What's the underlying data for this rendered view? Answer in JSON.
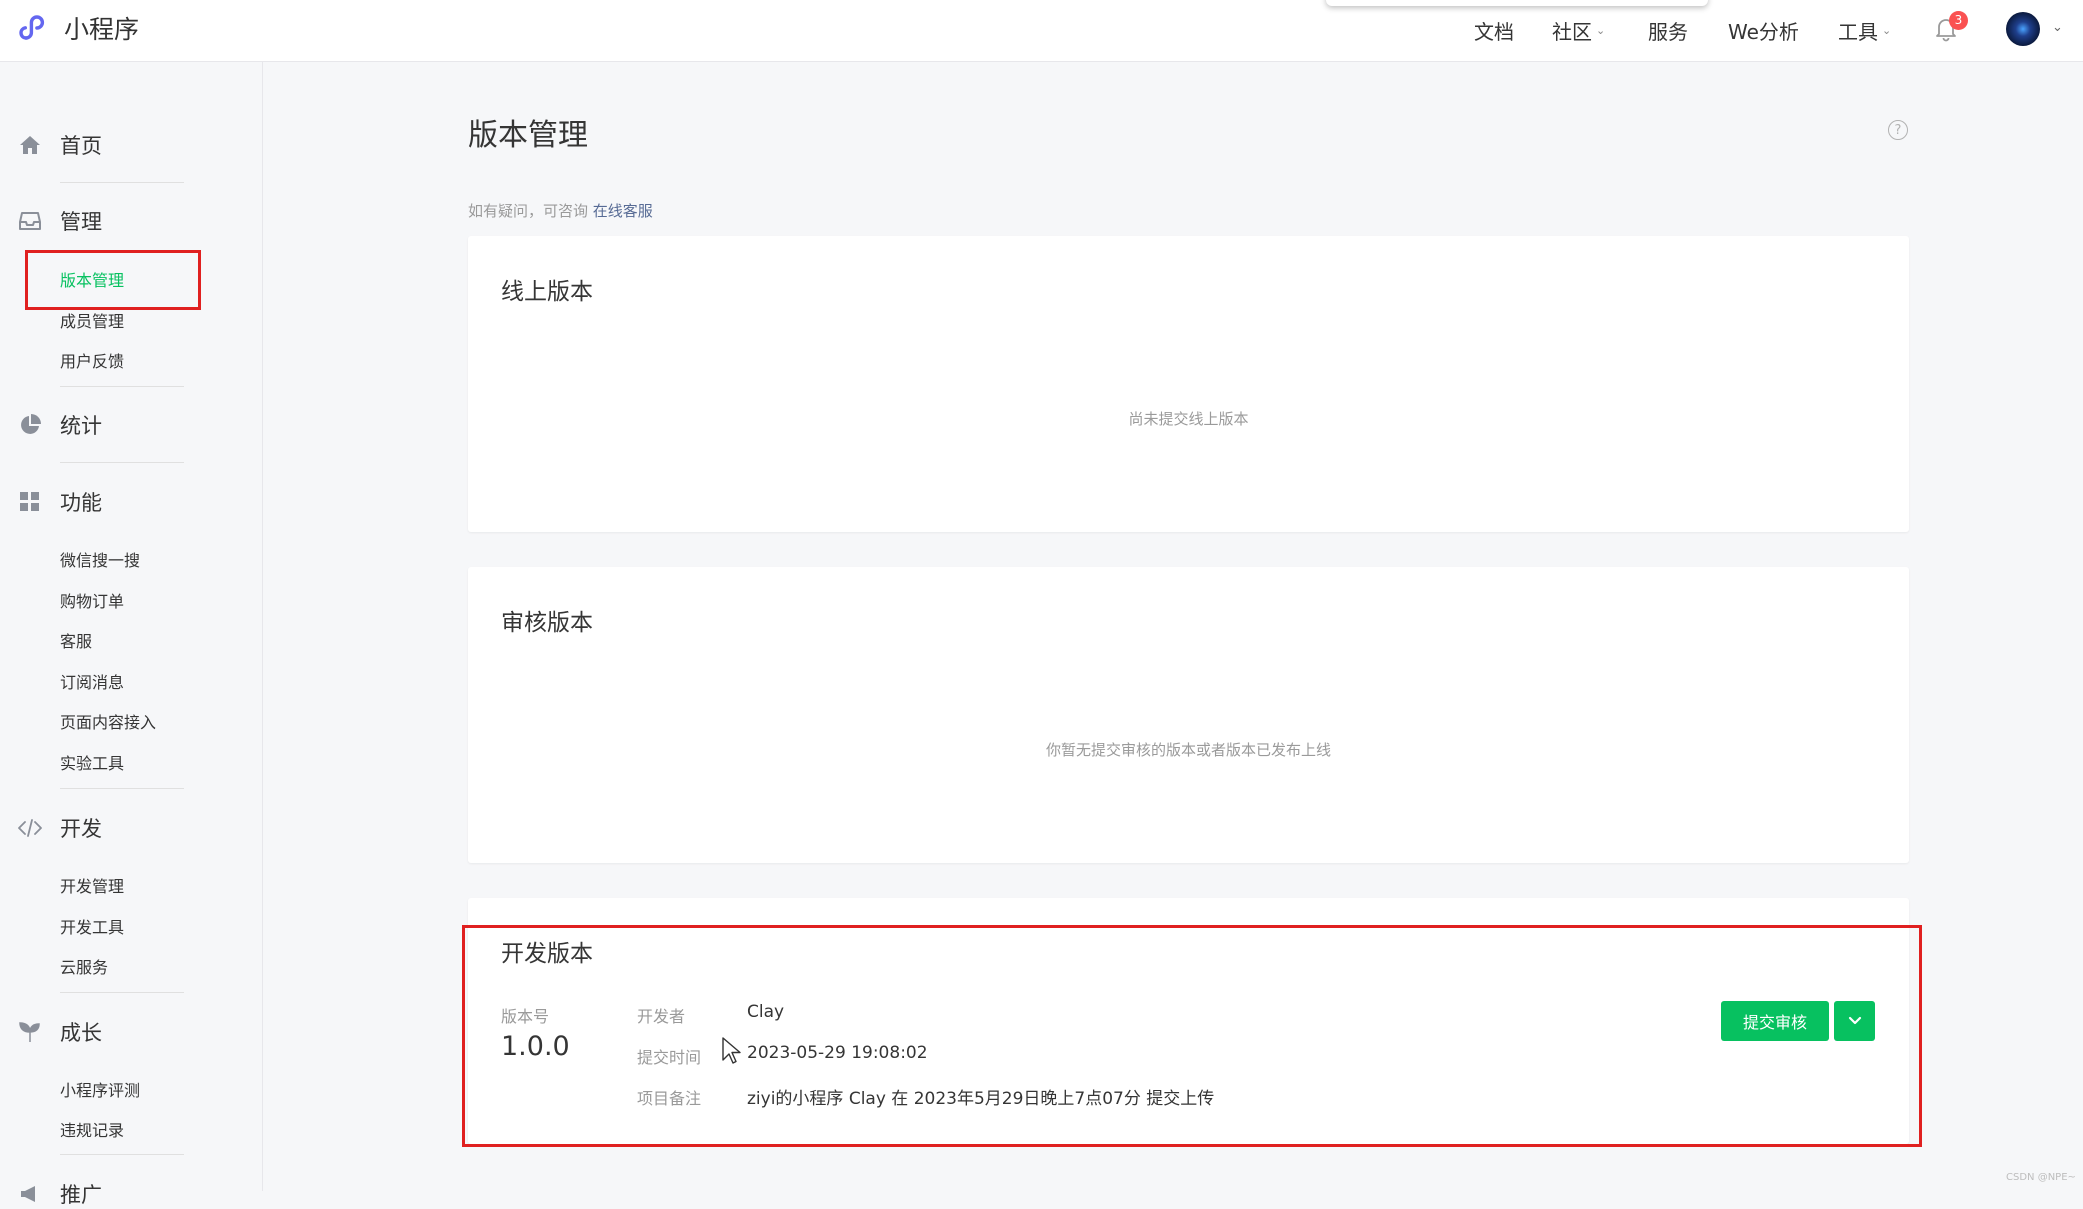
{
  "header": {
    "app_name": "小程序",
    "nav": [
      {
        "label": "文档",
        "has_dropdown": false
      },
      {
        "label": "社区",
        "has_dropdown": true
      },
      {
        "label": "服务",
        "has_dropdown": false
      },
      {
        "label": "We分析",
        "has_dropdown": false
      },
      {
        "label": "工具",
        "has_dropdown": true
      }
    ],
    "notification_count": "3",
    "icons": [
      "miniprogram-logo-icon",
      "bell-icon",
      "avatar",
      "chevron-down-icon"
    ]
  },
  "sidebar": {
    "groups": [
      {
        "label": "首页",
        "icon": "home-icon",
        "items": []
      },
      {
        "label": "管理",
        "icon": "inbox-icon",
        "items": [
          "版本管理",
          "成员管理",
          "用户反馈"
        ]
      },
      {
        "label": "统计",
        "icon": "pie-chart-icon",
        "items": []
      },
      {
        "label": "功能",
        "icon": "grid-icon",
        "items": [
          "微信搜一搜",
          "购物订单",
          "客服",
          "订阅消息",
          "页面内容接入",
          "实验工具"
        ]
      },
      {
        "label": "开发",
        "icon": "code-icon",
        "items": [
          "开发管理",
          "开发工具",
          "云服务"
        ]
      },
      {
        "label": "成长",
        "icon": "sprout-icon",
        "items": [
          "小程序评测",
          "违规记录"
        ]
      },
      {
        "label": "推广",
        "icon": "megaphone-icon",
        "items": []
      }
    ],
    "active_item": "版本管理"
  },
  "main": {
    "title": "版本管理",
    "hint_text": "如有疑问，可咨询 ",
    "hint_link": "在线客服",
    "online_version": {
      "title": "线上版本",
      "empty_text": "尚未提交线上版本"
    },
    "review_version": {
      "title": "审核版本",
      "empty_text": "你暂无提交审核的版本或者版本已发布上线"
    },
    "dev_version": {
      "title": "开发版本",
      "version_label": "版本号",
      "version": "1.0.0",
      "developer_label": "开发者",
      "developer": "Clay",
      "submit_time_label": "提交时间",
      "submit_time": "2023-05-29 19:08:02",
      "note_label": "项目备注",
      "note": "ziyi的小程序 Clay 在 2023年5月29日晚上7点07分 提交上传",
      "submit_button": "提交审核"
    }
  },
  "watermark": "CSDN @NPE~",
  "colors": {
    "accent": "#07c160",
    "link": "#576b95",
    "highlight_box": "#e02020",
    "badge": "#fa5151"
  }
}
